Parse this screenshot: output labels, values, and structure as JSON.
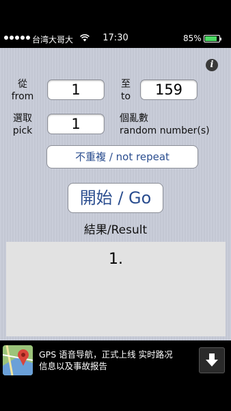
{
  "status_bar": {
    "carrier": "台湾大哥大",
    "time": "17:30",
    "battery": "85%"
  },
  "form": {
    "from_label_cn": "從",
    "from_label_en": "from",
    "from_value": "1",
    "to_label_cn": "至",
    "to_label_en": "to",
    "to_value": "159",
    "pick_label_cn": "選取",
    "pick_label_en": "pick",
    "pick_value": "1",
    "random_label_cn": "個亂數",
    "random_label_en": "random number(s)"
  },
  "buttons": {
    "not_repeat": "不重複 / not repeat",
    "go": "開始 / Go"
  },
  "result": {
    "title": "結果/Result",
    "items": [
      "1."
    ]
  },
  "ad": {
    "line1": "GPS 语音导航，正式上线 实时路况",
    "line2": "信息以及事故报告"
  },
  "icons": {
    "info": "info-icon",
    "wifi": "wifi-icon",
    "battery": "battery-icon",
    "ad_app": "maps-app-icon",
    "download": "download-arrow-icon"
  },
  "colors": {
    "accent_text": "#2a4d8f",
    "battery_fill": "#4cd964",
    "result_bg": "#e2e2e2"
  }
}
